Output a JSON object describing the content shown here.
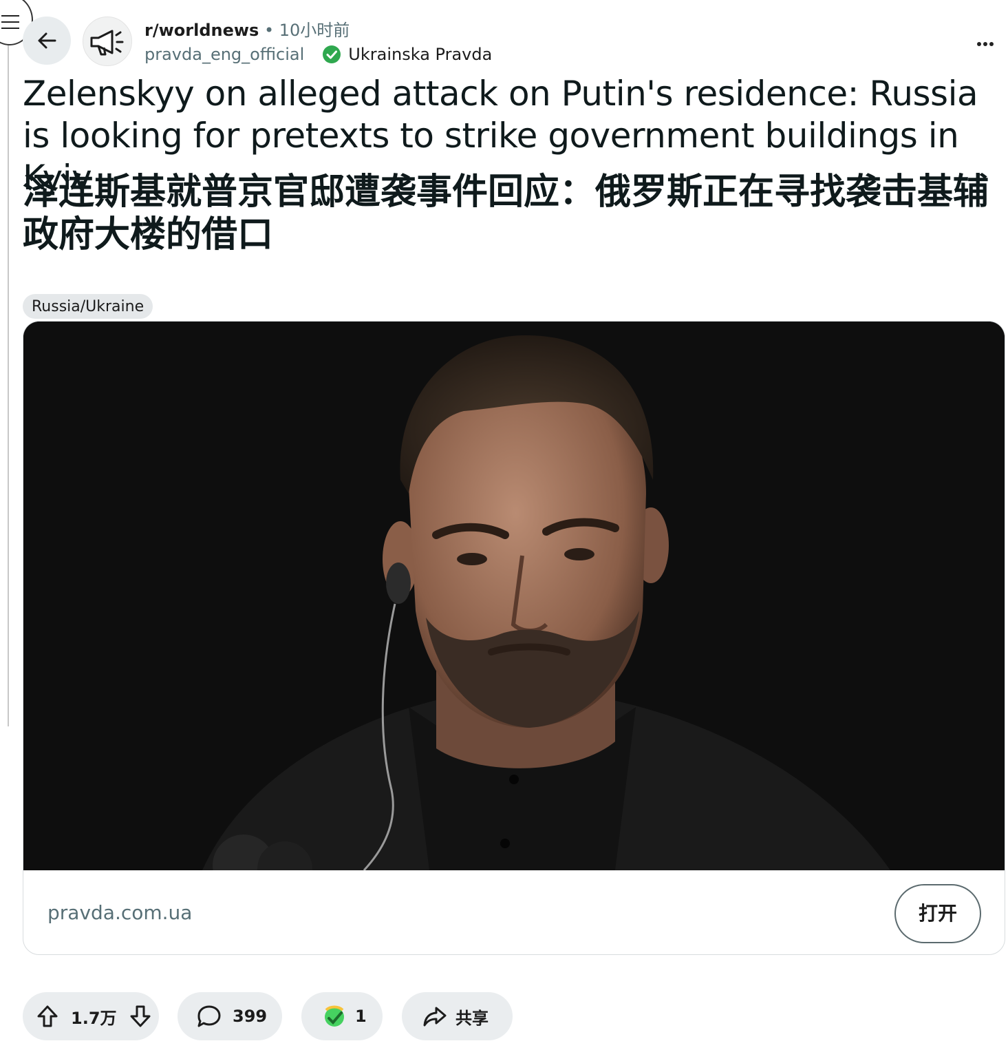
{
  "header": {
    "subreddit": "r/worldnews",
    "separator": "•",
    "time": "10小时前",
    "author": "pravda_eng_official",
    "verified_label": "Ukrainska Pravda",
    "icons": {
      "menu": "hamburger-icon",
      "back": "back-arrow-icon",
      "avatar": "megaphone-icon",
      "verified": "check-circle-icon",
      "more": "more-dots-icon"
    }
  },
  "post": {
    "title_en": "Zelenskyy on alleged attack on Putin's residence: Russia is looking for pretexts to strike government buildings in Kyiv",
    "title_zh": "泽连斯基就普京官邸遭袭事件回应：俄罗斯正在寻找袭击基辅政府大楼的借口",
    "flair": "Russia/Ukraine"
  },
  "link_card": {
    "domain": "pravda.com.ua",
    "open_label": "打开"
  },
  "actions": {
    "votes": "1.7万",
    "comments": "399",
    "awards": "1",
    "share_label": "共享"
  },
  "colors": {
    "verified_green": "#2fa84f",
    "pill_bg": "#eaedef",
    "muted_text": "#576f76"
  }
}
